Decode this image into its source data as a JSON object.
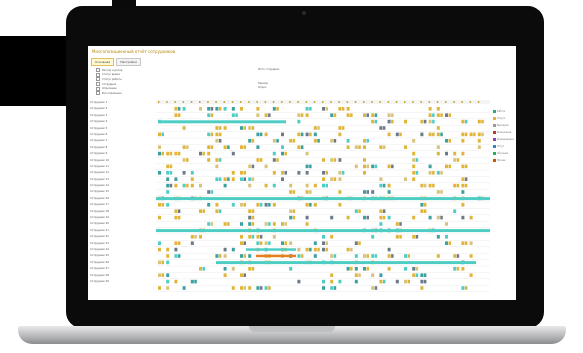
{
  "window": {
    "title": "Многопозиционный отчёт сотрудников",
    "tabs": [
      {
        "label": "Основная",
        "active": true
      },
      {
        "label": "Настройки",
        "active": false
      }
    ]
  },
  "filters": {
    "left": [
      "Расход и доход",
      "Статус время",
      "Статус работы",
      "Сотрудник",
      "Отделение",
      "Все отделения"
    ],
    "right": [
      "Фото сотрудник",
      "",
      "",
      "Период",
      "Отдел",
      ""
    ]
  },
  "rows": [
    "Сотрудник 1",
    "Сотрудник 2",
    "Сотрудник 3",
    "Сотрудник 4",
    "Сотрудник 5",
    "Сотрудник 6",
    "Сотрудник 7",
    "Сотрудник 8",
    "Сотрудник 9",
    "Сотрудник 10",
    "Сотрудник 11",
    "Сотрудник 12",
    "Сотрудник 13",
    "Сотрудник 14",
    "Сотрудник 15",
    "Сотрудник 16",
    "Сотрудник 17",
    "Сотрудник 18",
    "Сотрудник 19",
    "Сотрудник 20",
    "Сотрудник 21",
    "Сотрудник 22",
    "Сотрудник 23",
    "Сотрудник 24",
    "Сотрудник 25",
    "Сотрудник 26",
    "Сотрудник 27",
    "Сотрудник 28",
    "Сотрудник 29"
  ],
  "legend": [
    {
      "label": "Работа",
      "color": "#2aa88a"
    },
    {
      "label": "Отпуск",
      "color": "#e0b53a"
    },
    {
      "label": "Выходной",
      "color": "#9a9a9a"
    },
    {
      "label": "Больничный",
      "color": "#c0392b"
    },
    {
      "label": "Командировка",
      "color": "#8e44ad"
    },
    {
      "label": "Отгул",
      "color": "#2e86c1"
    },
    {
      "label": "Обучение",
      "color": "#27ae60"
    },
    {
      "label": "Прочее",
      "color": "#d35400"
    }
  ],
  "colors": {
    "accent": "#e0b53a",
    "teal": "#4ecdc4",
    "brand": "#b8860b"
  }
}
